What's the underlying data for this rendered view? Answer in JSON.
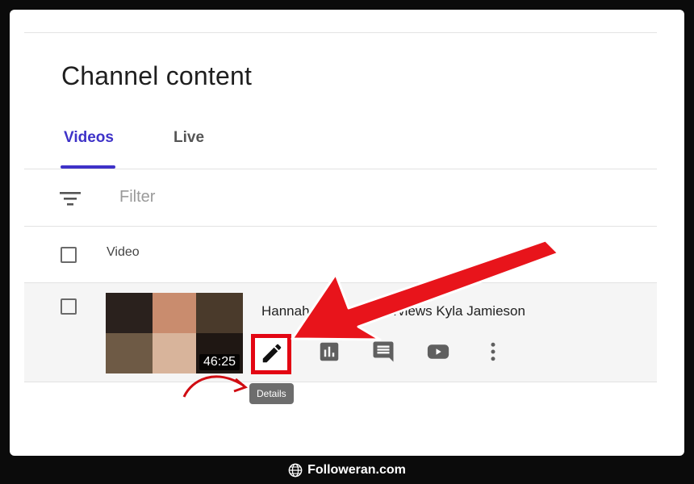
{
  "page": {
    "title": "Channel content"
  },
  "tabs": [
    {
      "label": "Videos",
      "active": true
    },
    {
      "label": "Live",
      "active": false
    }
  ],
  "filter": {
    "placeholder": "Filter"
  },
  "table": {
    "column_video": "Video",
    "rows": [
      {
        "title": "Hannah Montana Interviews Kyla Jamieson",
        "duration": "46:25"
      }
    ]
  },
  "actions": {
    "icons": [
      "pencil-icon",
      "analytics-icon",
      "comments-icon",
      "youtube-icon",
      "more-vert-icon"
    ],
    "tooltip": "Details"
  },
  "watermark": {
    "text": "Followeran.com"
  },
  "colors": {
    "accent": "#3e32c8",
    "highlight_red": "#e30613"
  }
}
